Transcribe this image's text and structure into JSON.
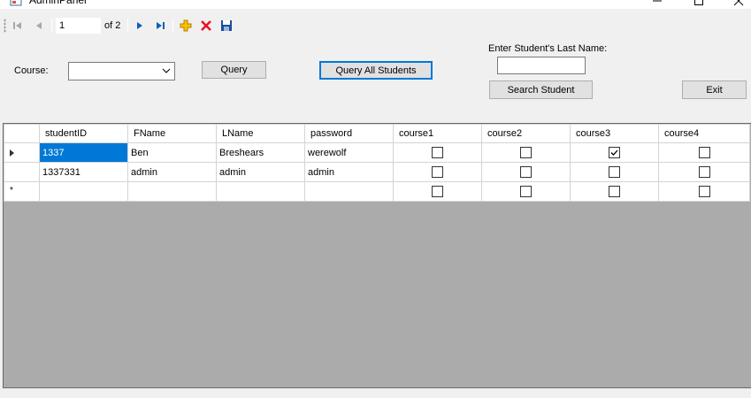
{
  "window": {
    "title": "AdminPanel"
  },
  "navigator": {
    "position": "1",
    "count_label": "of 2"
  },
  "form": {
    "course_label": "Course:",
    "course_value": "",
    "query_button": "Query",
    "query_all_button": "Query All Students",
    "last_name_label": "Enter Student's Last Name:",
    "last_name_value": "",
    "search_button": "Search Student",
    "exit_button": "Exit"
  },
  "grid": {
    "columns": [
      "studentID",
      "FName",
      "LName",
      "password",
      "course1",
      "course2",
      "course3",
      "course4"
    ],
    "rows": [
      {
        "studentID": "1337",
        "FName": "Ben",
        "LName": "Breshears",
        "password": "werewolf",
        "course1": false,
        "course2": false,
        "course3": true,
        "course4": false
      },
      {
        "studentID": "1337331",
        "FName": "admin",
        "LName": "admin",
        "password": "admin",
        "course1": false,
        "course2": false,
        "course3": false,
        "course4": false
      },
      {
        "studentID": "",
        "FName": "",
        "LName": "",
        "password": "",
        "course1": false,
        "course2": false,
        "course3": false,
        "course4": false
      }
    ],
    "new_row_marker": "*"
  },
  "colors": {
    "selection": "#0078d7",
    "grid_background": "#ababab",
    "delete_icon": "#e81123",
    "add_icon": "#e8a200",
    "nav_icon": "#0b5fb8"
  }
}
